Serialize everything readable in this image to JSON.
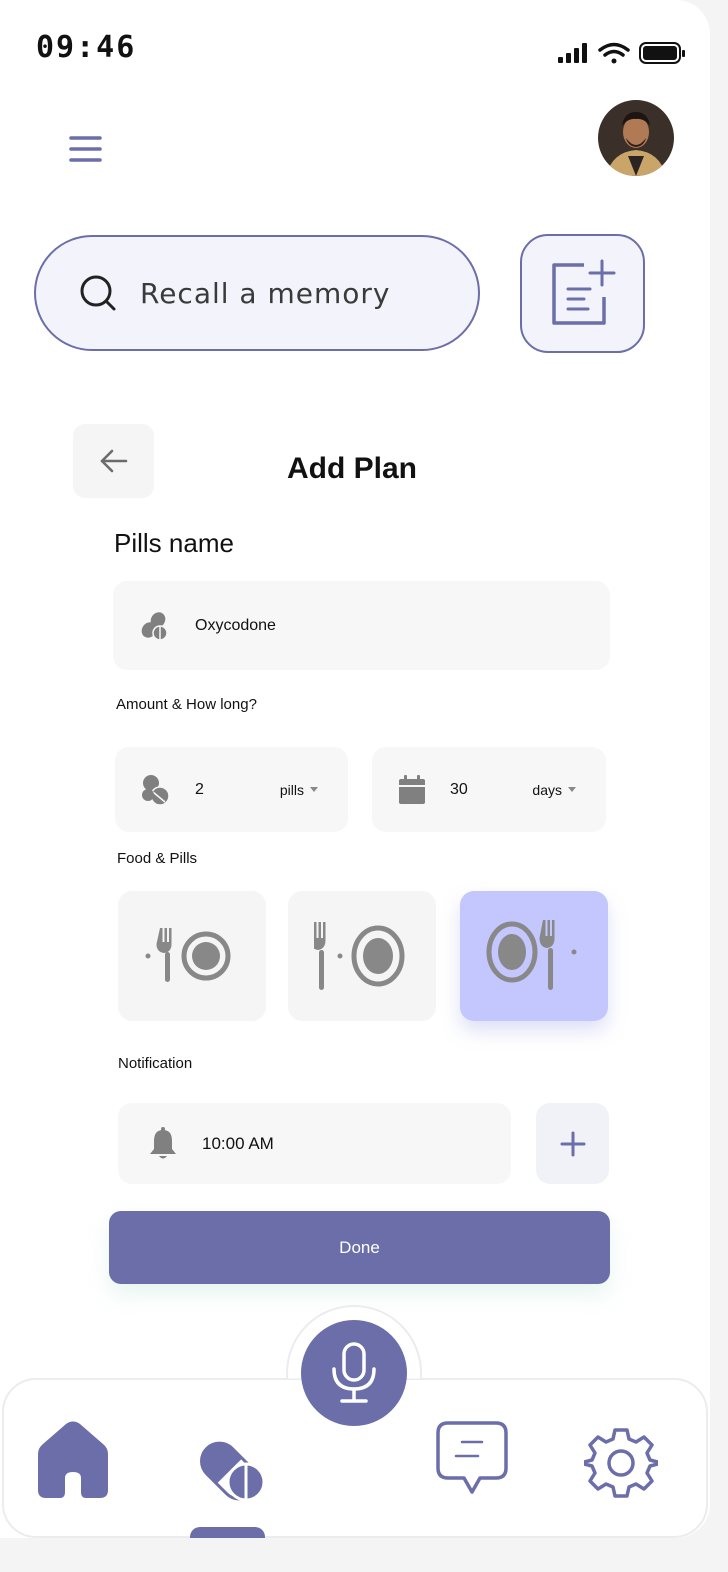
{
  "status_bar": {
    "time": "09:46"
  },
  "search": {
    "placeholder": "Recall a memory"
  },
  "page": {
    "title": "Add Plan"
  },
  "pills_name": {
    "label": "Pills name",
    "value": "Oxycodone"
  },
  "amount": {
    "label": "Amount & How long?",
    "quantity": "2",
    "quantity_unit": "pills",
    "duration": "30",
    "duration_unit": "days"
  },
  "food": {
    "label": "Food & Pills",
    "options": [
      "before-meal-icon",
      "between-meal-icon",
      "after-meal-icon"
    ],
    "selected_index": 2
  },
  "notification": {
    "label": "Notification",
    "time": "10:00 AM"
  },
  "done_label": "Done",
  "bottom_nav": {
    "items": [
      "home-icon",
      "pills-icon",
      "microphone-icon",
      "chat-icon",
      "settings-icon"
    ],
    "active": "pills-icon"
  },
  "colors": {
    "accent": "#6b6ea8",
    "selected": "#c4c6fe",
    "field": "#f7f7f7"
  }
}
